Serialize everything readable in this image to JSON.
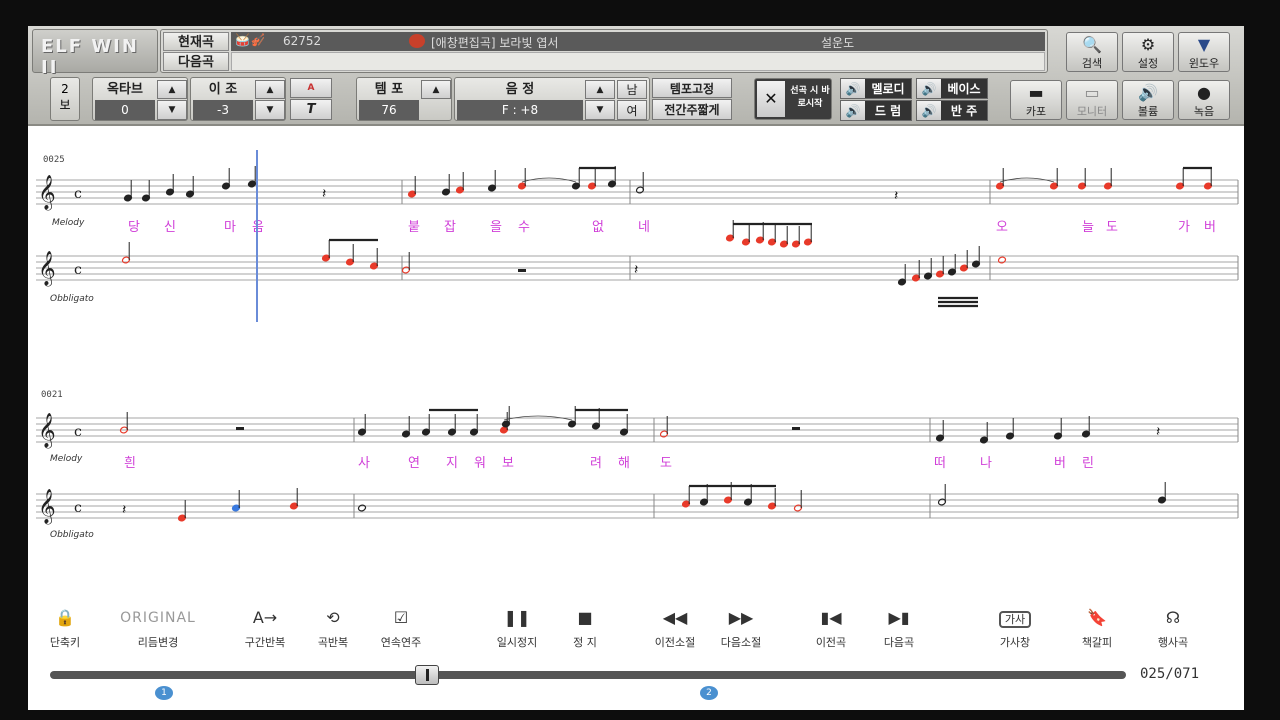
{
  "app": {
    "logo": "ELF WIN II"
  },
  "header": {
    "current_label": "현재곡",
    "next_label": "다음곡",
    "song_number": "62752",
    "song_title": "[애창편집곡] 보라빛 엽서",
    "artist": "설운도",
    "next_song": ""
  },
  "controls": {
    "view_num": "2",
    "view_label": "보",
    "octave": {
      "label": "옥타브",
      "value": "0"
    },
    "transpose": {
      "label": "이 조",
      "value": "-3"
    },
    "tempo": {
      "label": "템 포",
      "value": "76"
    },
    "key": {
      "label": "음 정",
      "value": "F : +8",
      "male": "남",
      "female": "여"
    },
    "tempo_fix": "템포고정",
    "short_intro": "전간주짧게",
    "start_immediately": "선곡 시 바로시작",
    "mix": {
      "melody": "멜로디",
      "bass": "베이스",
      "drum": "드 럼",
      "accomp": "반 주"
    },
    "capo": "카포",
    "monitor": "모니터",
    "volume": "볼륨",
    "record": "녹음"
  },
  "top_buttons": {
    "search": "검색",
    "settings": "설정",
    "window": "윈도우"
  },
  "score": {
    "system1": {
      "measure": "0025",
      "melody_label": "Melody",
      "obbligato_label": "Obbligato",
      "lyrics": [
        "당",
        "신",
        "마",
        "음",
        "붙",
        "잡",
        "을",
        "수",
        "없",
        "네",
        "오",
        "늘",
        "도",
        "가",
        "버"
      ]
    },
    "system2": {
      "measure": "0021",
      "melody_label": "Melody",
      "obbligato_label": "Obbligato",
      "lyrics": [
        "흰",
        "사",
        "연",
        "지",
        "워",
        "보",
        "려",
        "해",
        "도",
        "떠",
        "나",
        "버",
        "린"
      ]
    },
    "accent": "#e83a2a",
    "blue_note": "#3a7ae0",
    "lyric_color": "#d040d8"
  },
  "bottom": {
    "shortcut": "단축키",
    "rhythm_text": "ORIGINAL",
    "rhythm": "리듬변경",
    "section_repeat": "구간반복",
    "song_repeat": "곡반복",
    "continuous": "연속연주",
    "pause": "일시정지",
    "stop": "정 지",
    "prev_bar": "이전소절",
    "next_bar": "다음소절",
    "prev_song": "이전곡",
    "next_song": "다음곡",
    "lyrics_window": "가사창",
    "lyrics_icon": "가사",
    "bookmark": "책갈피",
    "event_song": "행사곡",
    "position": "025/071",
    "progress": 0.35,
    "marker1": "1",
    "marker2": "2"
  }
}
